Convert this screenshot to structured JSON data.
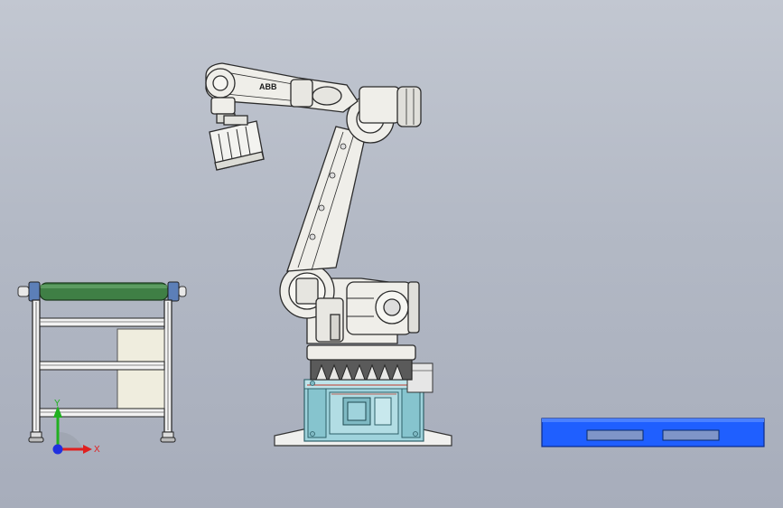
{
  "robot": {
    "brand": "ABB"
  },
  "triad": {
    "x_label": "X",
    "y_label": "Y"
  },
  "colors": {
    "background_top": "#c2c7d1",
    "background_bottom": "#a7adbb",
    "robot_body": "#efeee9",
    "robot_outline": "#2b2b2b",
    "conveyor_roller": "#3f7f45",
    "base_fixture": "#9fd3dc",
    "pallet": "#1f5fff",
    "axis_x": "#e02020",
    "axis_y": "#20b020",
    "axis_z": "#2030e0"
  }
}
